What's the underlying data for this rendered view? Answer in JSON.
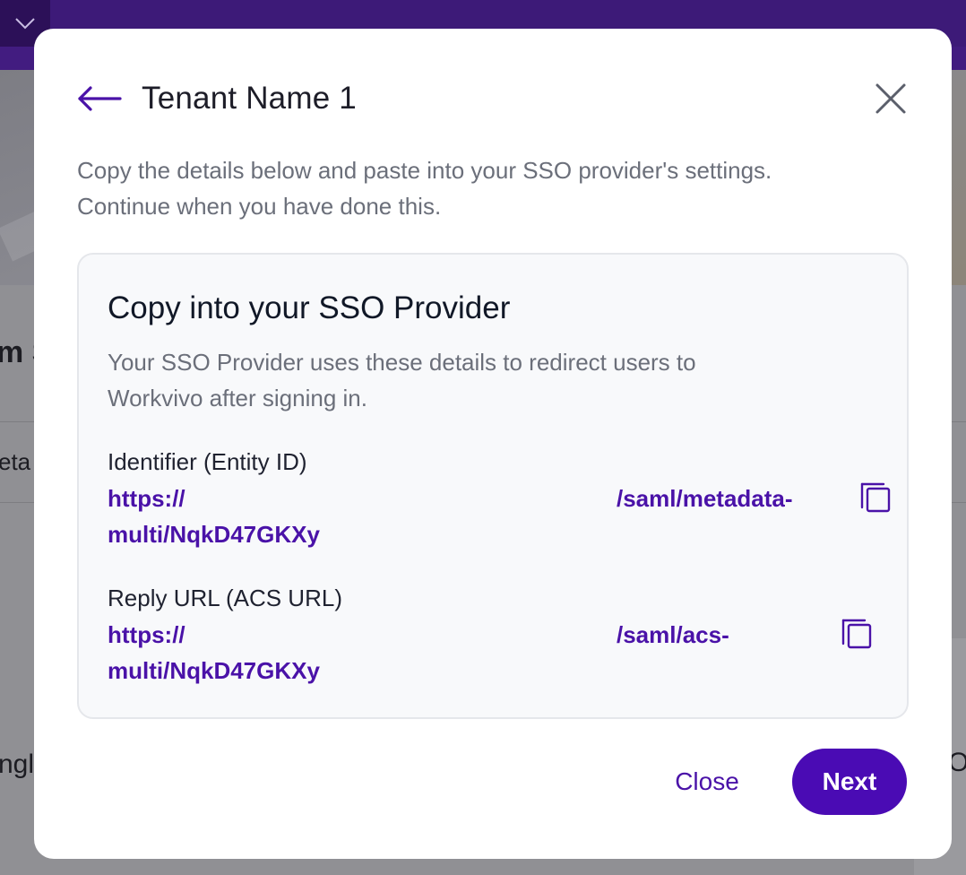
{
  "background": {
    "partial_text_heading": "m S",
    "partial_text_field": "eta",
    "partial_text_lower": "ngl",
    "partial_text_right": "O"
  },
  "modal": {
    "title": "Tenant Name 1",
    "intro_line1": "Copy the details below and paste into your SSO provider's settings.",
    "intro_line2": "Continue when you have done this.",
    "card": {
      "title": "Copy into your SSO Provider",
      "desc_line1": "Your SSO Provider uses these details to redirect users to",
      "desc_line2": "Workvivo after signing in.",
      "fields": [
        {
          "label": "Identifier (Entity ID)",
          "url_start": "https://",
          "url_middle": "/saml/metadata-",
          "url_end": "multi/NqkD47GKXy"
        },
        {
          "label": "Reply URL (ACS URL)",
          "url_start": "https://",
          "url_middle": "/saml/acs-",
          "url_end": "multi/NqkD47GKXy"
        }
      ]
    },
    "buttons": {
      "close": "Close",
      "next": "Next"
    }
  },
  "colors": {
    "brand": "#4a0bb4",
    "link": "#4a12a8",
    "topbar": "#3d1a78"
  },
  "icons": [
    "chevron-down-icon",
    "arrow-left-icon",
    "close-icon",
    "copy-icon"
  ]
}
